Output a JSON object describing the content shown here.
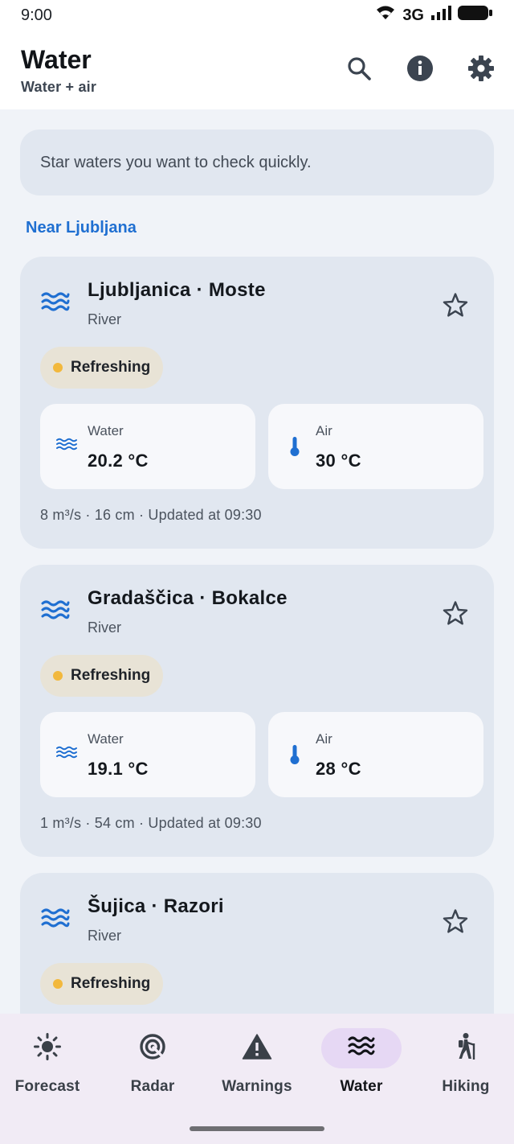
{
  "status_bar": {
    "time": "9:00",
    "network": "3G"
  },
  "app_bar": {
    "title": "Water",
    "subtitle": "Water + air",
    "actions": [
      "search-icon",
      "info-icon",
      "settings-icon"
    ]
  },
  "hint": "Star waters you want to check quickly.",
  "section_title": "Near Ljubljana",
  "cards": [
    {
      "name": "Ljubljanica · Moste",
      "type": "River",
      "status": "Refreshing",
      "water_label": "Water",
      "water_value": "20.2 °C",
      "air_label": "Air",
      "air_value": "30 °C",
      "meta": "8 m³/s · 16 cm · Updated at 09:30"
    },
    {
      "name": "Gradaščica · Bokalce",
      "type": "River",
      "status": "Refreshing",
      "water_label": "Water",
      "water_value": "19.1 °C",
      "air_label": "Air",
      "air_value": "28 °C",
      "meta": "1 m³/s · 54 cm · Updated at 09:30"
    },
    {
      "name": "Šujica · Razori",
      "type": "River",
      "status": "Refreshing"
    }
  ],
  "nav": [
    {
      "label": "Forecast",
      "icon": "sun-icon"
    },
    {
      "label": "Radar",
      "icon": "radar-icon"
    },
    {
      "label": "Warnings",
      "icon": "warning-icon"
    },
    {
      "label": "Water",
      "icon": "waves-icon",
      "active": true
    },
    {
      "label": "Hiking",
      "icon": "hiker-icon"
    }
  ],
  "colors": {
    "accent": "#1f6fd1",
    "card_bg": "#e1e7f0",
    "badge_bg": "#e8e3d6",
    "status_dot": "#f2b83c",
    "nav_bg": "#f1ebf5",
    "nav_active": "#e6d8f4"
  }
}
